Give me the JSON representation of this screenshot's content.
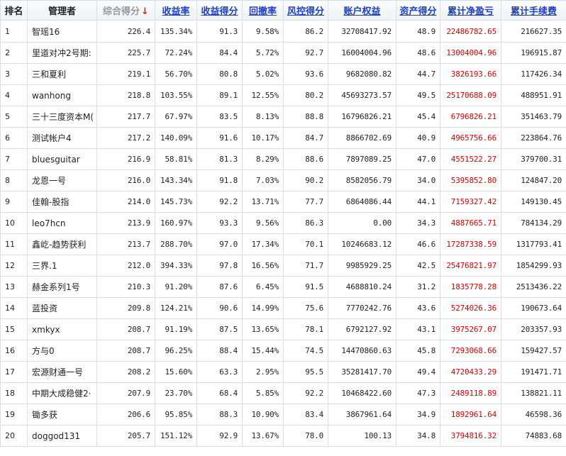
{
  "headers": {
    "rank": "排名",
    "manager": "管理者",
    "score": "综合得分",
    "sort_arrow": "↓",
    "return_rate": "收益率",
    "return_score": "收益得分",
    "drawdown": "回撤率",
    "risk_score": "风控得分",
    "equity": "账户权益",
    "asset_score": "资产得分",
    "cum_pnl": "累计净盈亏",
    "cum_fee": "累计手续费"
  },
  "rows": [
    {
      "rank": "1",
      "manager": "智瑶16",
      "score": "226.4",
      "return_rate": "135.34%",
      "return_score": "91.3",
      "drawdown": "9.58%",
      "risk_score": "86.2",
      "equity": "32708417.92",
      "asset_score": "48.9",
      "cum_pnl": "22486782.65",
      "cum_fee": "216627.35"
    },
    {
      "rank": "2",
      "manager": "里道对冲2号期:",
      "score": "225.7",
      "return_rate": "72.24%",
      "return_score": "84.4",
      "drawdown": "5.72%",
      "risk_score": "92.7",
      "equity": "16004004.96",
      "asset_score": "48.6",
      "cum_pnl": "13004004.96",
      "cum_fee": "196915.87"
    },
    {
      "rank": "3",
      "manager": "三和夏利",
      "score": "219.1",
      "return_rate": "56.70%",
      "return_score": "80.8",
      "drawdown": "5.02%",
      "risk_score": "93.6",
      "equity": "9682080.82",
      "asset_score": "44.7",
      "cum_pnl": "3826193.66",
      "cum_fee": "117426.34"
    },
    {
      "rank": "4",
      "manager": "wanhong",
      "score": "218.8",
      "return_rate": "103.55%",
      "return_score": "89.1",
      "drawdown": "12.55%",
      "risk_score": "80.2",
      "equity": "45693273.57",
      "asset_score": "49.5",
      "cum_pnl": "25170688.09",
      "cum_fee": "488951.91"
    },
    {
      "rank": "5",
      "manager": "三十三度资本M(",
      "score": "217.7",
      "return_rate": "67.97%",
      "return_score": "83.5",
      "drawdown": "8.13%",
      "risk_score": "88.8",
      "equity": "16796826.21",
      "asset_score": "45.4",
      "cum_pnl": "6796826.21",
      "cum_fee": "351463.79"
    },
    {
      "rank": "6",
      "manager": "测试帐户4",
      "score": "217.2",
      "return_rate": "140.09%",
      "return_score": "91.6",
      "drawdown": "10.17%",
      "risk_score": "84.7",
      "equity": "8866702.69",
      "asset_score": "40.9",
      "cum_pnl": "4965756.66",
      "cum_fee": "223864.76"
    },
    {
      "rank": "7",
      "manager": "bluesguitar",
      "score": "216.9",
      "return_rate": "58.81%",
      "return_score": "81.3",
      "drawdown": "8.29%",
      "risk_score": "88.6",
      "equity": "7897089.25",
      "asset_score": "47.0",
      "cum_pnl": "4551522.27",
      "cum_fee": "379700.31"
    },
    {
      "rank": "8",
      "manager": "龙恩一号",
      "score": "216.0",
      "return_rate": "143.34%",
      "return_score": "91.8",
      "drawdown": "7.03%",
      "risk_score": "90.2",
      "equity": "8582056.79",
      "asset_score": "34.0",
      "cum_pnl": "5395852.80",
      "cum_fee": "124847.20"
    },
    {
      "rank": "9",
      "manager": "佳翰-股指",
      "score": "214.0",
      "return_rate": "145.73%",
      "return_score": "92.2",
      "drawdown": "13.71%",
      "risk_score": "77.7",
      "equity": "6864086.44",
      "asset_score": "44.1",
      "cum_pnl": "7159327.42",
      "cum_fee": "149130.45"
    },
    {
      "rank": "10",
      "manager": "leo7hcn",
      "score": "213.9",
      "return_rate": "160.97%",
      "return_score": "93.3",
      "drawdown": "9.56%",
      "risk_score": "86.3",
      "equity": "0.00",
      "asset_score": "34.3",
      "cum_pnl": "4887665.71",
      "cum_fee": "784134.29"
    },
    {
      "rank": "11",
      "manager": "鑫屹-趋势获利",
      "score": "213.7",
      "return_rate": "288.70%",
      "return_score": "97.0",
      "drawdown": "17.34%",
      "risk_score": "70.1",
      "equity": "10246683.12",
      "asset_score": "46.6",
      "cum_pnl": "17287338.59",
      "cum_fee": "1317793.41"
    },
    {
      "rank": "12",
      "manager": "三界.1",
      "score": "212.0",
      "return_rate": "394.33%",
      "return_score": "97.8",
      "drawdown": "16.56%",
      "risk_score": "71.7",
      "equity": "9985929.25",
      "asset_score": "42.5",
      "cum_pnl": "25476821.97",
      "cum_fee": "1854299.93"
    },
    {
      "rank": "13",
      "manager": "赫金系列1号",
      "score": "210.3",
      "return_rate": "91.20%",
      "return_score": "87.6",
      "drawdown": "6.45%",
      "risk_score": "91.5",
      "equity": "4688810.24",
      "asset_score": "31.2",
      "cum_pnl": "1835778.28",
      "cum_fee": "2513436.22"
    },
    {
      "rank": "14",
      "manager": "蓝投资",
      "score": "209.8",
      "return_rate": "124.21%",
      "return_score": "90.6",
      "drawdown": "14.99%",
      "risk_score": "75.6",
      "equity": "7770242.76",
      "asset_score": "43.6",
      "cum_pnl": "5274026.36",
      "cum_fee": "190673.64"
    },
    {
      "rank": "15",
      "manager": "xmkyx",
      "score": "208.7",
      "return_rate": "91.19%",
      "return_score": "87.5",
      "drawdown": "13.65%",
      "risk_score": "78.1",
      "equity": "6792127.92",
      "asset_score": "43.1",
      "cum_pnl": "3975267.07",
      "cum_fee": "203357.93"
    },
    {
      "rank": "16",
      "manager": "方与0",
      "score": "208.7",
      "return_rate": "96.25%",
      "return_score": "88.4",
      "drawdown": "15.44%",
      "risk_score": "74.5",
      "equity": "14470860.63",
      "asset_score": "45.8",
      "cum_pnl": "7293068.66",
      "cum_fee": "159427.57"
    },
    {
      "rank": "17",
      "manager": "宏源财通一号",
      "score": "208.2",
      "return_rate": "15.60%",
      "return_score": "63.3",
      "drawdown": "2.95%",
      "risk_score": "95.5",
      "equity": "35281417.70",
      "asset_score": "49.4",
      "cum_pnl": "4720433.29",
      "cum_fee": "191471.71"
    },
    {
      "rank": "18",
      "manager": "中期大成稳健2·",
      "score": "207.9",
      "return_rate": "23.70%",
      "return_score": "68.4",
      "drawdown": "5.85%",
      "risk_score": "92.2",
      "equity": "10468422.60",
      "asset_score": "47.3",
      "cum_pnl": "2489118.89",
      "cum_fee": "138821.11"
    },
    {
      "rank": "19",
      "manager": "锄多获",
      "score": "206.6",
      "return_rate": "95.85%",
      "return_score": "88.3",
      "drawdown": "10.90%",
      "risk_score": "83.4",
      "equity": "3867961.64",
      "asset_score": "34.9",
      "cum_pnl": "1892961.64",
      "cum_fee": "46598.36"
    },
    {
      "rank": "20",
      "manager": "doggod131",
      "score": "205.7",
      "return_rate": "151.12%",
      "return_score": "92.9",
      "drawdown": "13.67%",
      "risk_score": "78.0",
      "equity": "100.13",
      "asset_score": "34.8",
      "cum_pnl": "3794816.32",
      "cum_fee": "74883.68"
    }
  ],
  "colors": {
    "link": "#1f3fc7",
    "negative_emphasis": "#d60000",
    "sort_arrow": "#e02020",
    "border": "#d6dfea"
  }
}
